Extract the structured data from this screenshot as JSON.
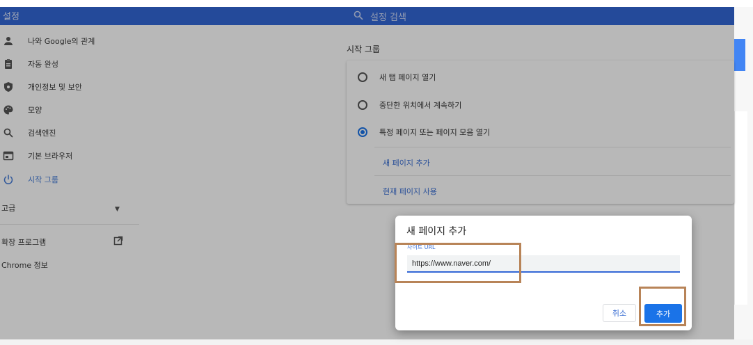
{
  "window": {
    "title": "설정",
    "search_placeholder": "설정 검색"
  },
  "sidebar": {
    "items": [
      {
        "label": "나와 Google의 관계",
        "icon": "person-icon"
      },
      {
        "label": "자동 완성",
        "icon": "clipboard-icon"
      },
      {
        "label": "개인정보 및 보안",
        "icon": "shield-icon"
      },
      {
        "label": "모양",
        "icon": "palette-icon"
      },
      {
        "label": "검색엔진",
        "icon": "search-icon"
      },
      {
        "label": "기본 브라우저",
        "icon": "browser-window-icon"
      },
      {
        "label": "시작 그룹",
        "icon": "power-icon",
        "active": true
      }
    ],
    "advanced_label": "고급",
    "extensions_label": "확장 프로그램",
    "about_label": "Chrome 정보"
  },
  "startup": {
    "section_title": "시작 그룹",
    "options": [
      {
        "label": "새 탭 페이지 열기",
        "checked": false
      },
      {
        "label": "중단한 위치에서 계속하기",
        "checked": false
      },
      {
        "label": "특정 페이지 또는 페이지 모음 열기",
        "checked": true
      }
    ],
    "add_page_link": "새 페이지 추가",
    "use_current_link": "현재 페이지 사용"
  },
  "dialog": {
    "title": "새 페이지 추가",
    "field_label": "사이트 URL",
    "url_value": "https://www.naver.com/",
    "cancel_label": "취소",
    "add_label": "추가"
  },
  "colors": {
    "accent": "#1a73e8",
    "header": "#3367d6",
    "highlight": "#b88458"
  }
}
